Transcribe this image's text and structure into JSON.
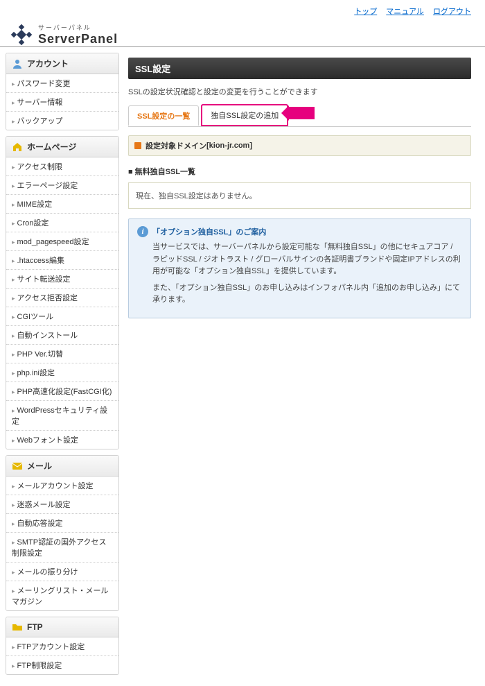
{
  "topLinks": {
    "top": "トップ",
    "manual": "マニュアル",
    "logout": "ログアウト"
  },
  "brand": {
    "sub": "サーバーパネル",
    "main": "ServerPanel"
  },
  "sidebar": {
    "sections": [
      {
        "title": "アカウント",
        "icon": "user",
        "items": [
          "パスワード変更",
          "サーバー情報",
          "バックアップ"
        ]
      },
      {
        "title": "ホームページ",
        "icon": "home",
        "items": [
          "アクセス制限",
          "エラーページ設定",
          "MIME設定",
          "Cron設定",
          "mod_pagespeed設定",
          ".htaccess編集",
          "サイト転送設定",
          "アクセス拒否設定",
          "CGIツール",
          "自動インストール",
          "PHP Ver.切替",
          "php.ini設定",
          "PHP高速化設定(FastCGI化)",
          "WordPressセキュリティ設定",
          "Webフォント設定"
        ]
      },
      {
        "title": "メール",
        "icon": "mail",
        "items": [
          "メールアカウント設定",
          "迷惑メール設定",
          "自動応答設定",
          "SMTP認証の国外アクセス制限設定",
          "メールの振り分け",
          "メーリングリスト・メールマガジン"
        ]
      },
      {
        "title": "FTP",
        "icon": "ftp",
        "items": [
          "FTPアカウント設定",
          "FTP制限設定"
        ]
      }
    ]
  },
  "main": {
    "title": "SSL設定",
    "desc": "SSLの設定状況確認と設定の変更を行うことができます",
    "tabs": {
      "list": "SSL設定の一覧",
      "add": "独自SSL設定の追加"
    },
    "domainLabel": "設定対象ドメイン",
    "domainValue": "[kion-jr.com]",
    "listTitle": "無料独自SSL一覧",
    "emptyMsg": "現在、独自SSL設定はありません。",
    "info": {
      "title": "「オプション独自SSL」のご案内",
      "p1": "当サービスでは、サーバーパネルから設定可能な「無料独自SSL」の他にセキュアコア / ラピッドSSL / ジオトラスト / グローバルサインの各証明書ブランドや固定IPアドレスの利用が可能な「オプション独自SSL」を提供しています。",
      "p2": "また、「オプション独自SSL」のお申し込みはインフォパネル内「追加のお申し込み」にて承ります。"
    }
  }
}
